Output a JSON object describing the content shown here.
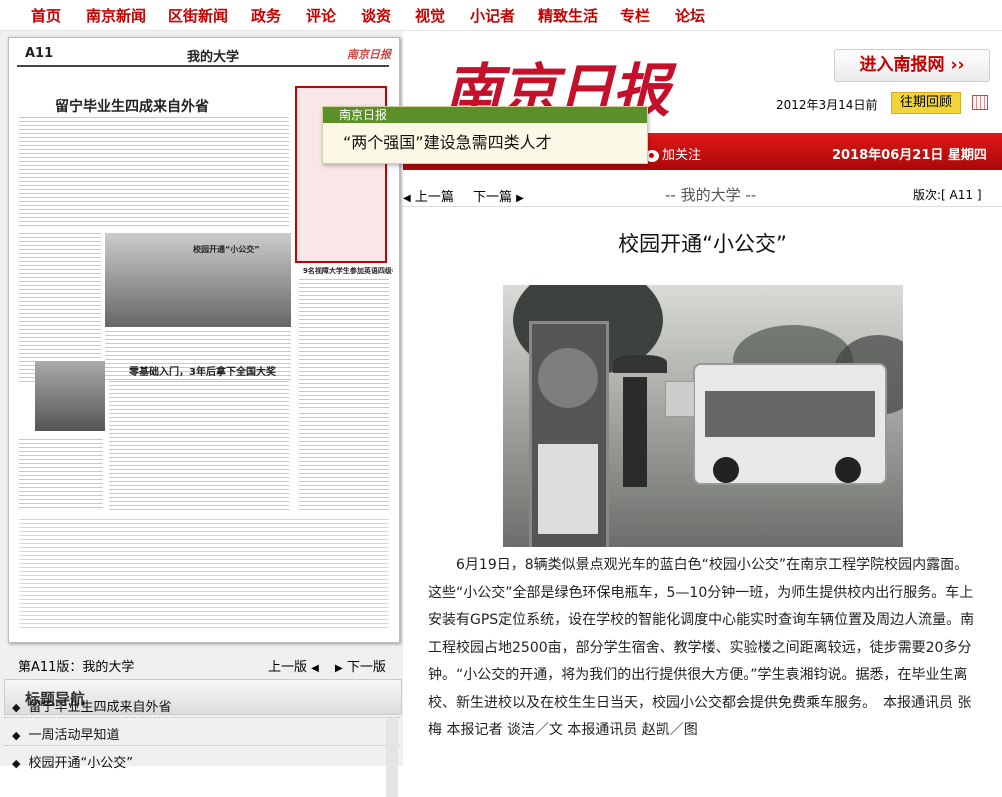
{
  "nav": {
    "items": [
      {
        "label": "首页"
      },
      {
        "label": "南京新闻"
      },
      {
        "label": "区街新闻"
      },
      {
        "label": "政务"
      },
      {
        "label": "评论"
      },
      {
        "label": "谈资"
      },
      {
        "label": "视觉"
      },
      {
        "label": "小记者"
      },
      {
        "label": "精致生活"
      },
      {
        "label": "专栏"
      },
      {
        "label": "论坛"
      }
    ]
  },
  "header": {
    "logo_text": "南京日报",
    "enter_button": "进入南报网 ››",
    "past_date": "2012年3月14日前",
    "history_button": "往期回顾",
    "follow": "加关注",
    "current_date": "2018年06月21日 星期四"
  },
  "thumb": {
    "page_label": "A11",
    "page_name": "我的大学",
    "lead_headline": "留宁毕业生四成来自外省",
    "sub_headline": "零基础入门，3年后拿下全国大奖",
    "center_headline": "校园开通“小公交”",
    "right_headline": "9名视障大学生参加英语四级考试"
  },
  "tooltip": {
    "source": "南京日报",
    "title": "“两个强国”建设急需四类人才"
  },
  "pager": {
    "edition": "第A11版：我的大学",
    "prev": "上一版",
    "next": "下一版"
  },
  "title_nav": {
    "header": "标题导航",
    "items": [
      {
        "label": "留宁毕业生四成来自外省"
      },
      {
        "label": "一周活动早知道"
      },
      {
        "label": "校园开通“小公交”"
      }
    ]
  },
  "article_nav": {
    "prev": "上一篇",
    "next": "下一篇",
    "section": "-- 我的大学 --",
    "edition": "版次:[ A11 ]"
  },
  "article": {
    "title": "校园开通“小公交”",
    "body": "6月19日，8辆类似景点观光车的蓝白色“校园小公交”在南京工程学院校园内露面。这些“小公交”全部是绿色环保电瓶车，5—10分钟一班，为师生提供校内出行服务。车上安装有GPS定位系统，设在学校的智能化调度中心能实时查询车辆位置及周边人流量。南工程校园占地2500亩，部分学生宿舍、教学楼、实验楼之间距离较远，徒步需要20多分钟。“小公交的开通，将为我们的出行提供很大方便。”学生袁湘钧说。据悉，在毕业生离校、新生进校以及在校生生日当天，校园小公交都会提供免费乘车服务。",
    "credit": "本报通讯员 张梅 本报记者 谈洁／文 本报通讯员 赵凯／图"
  }
}
